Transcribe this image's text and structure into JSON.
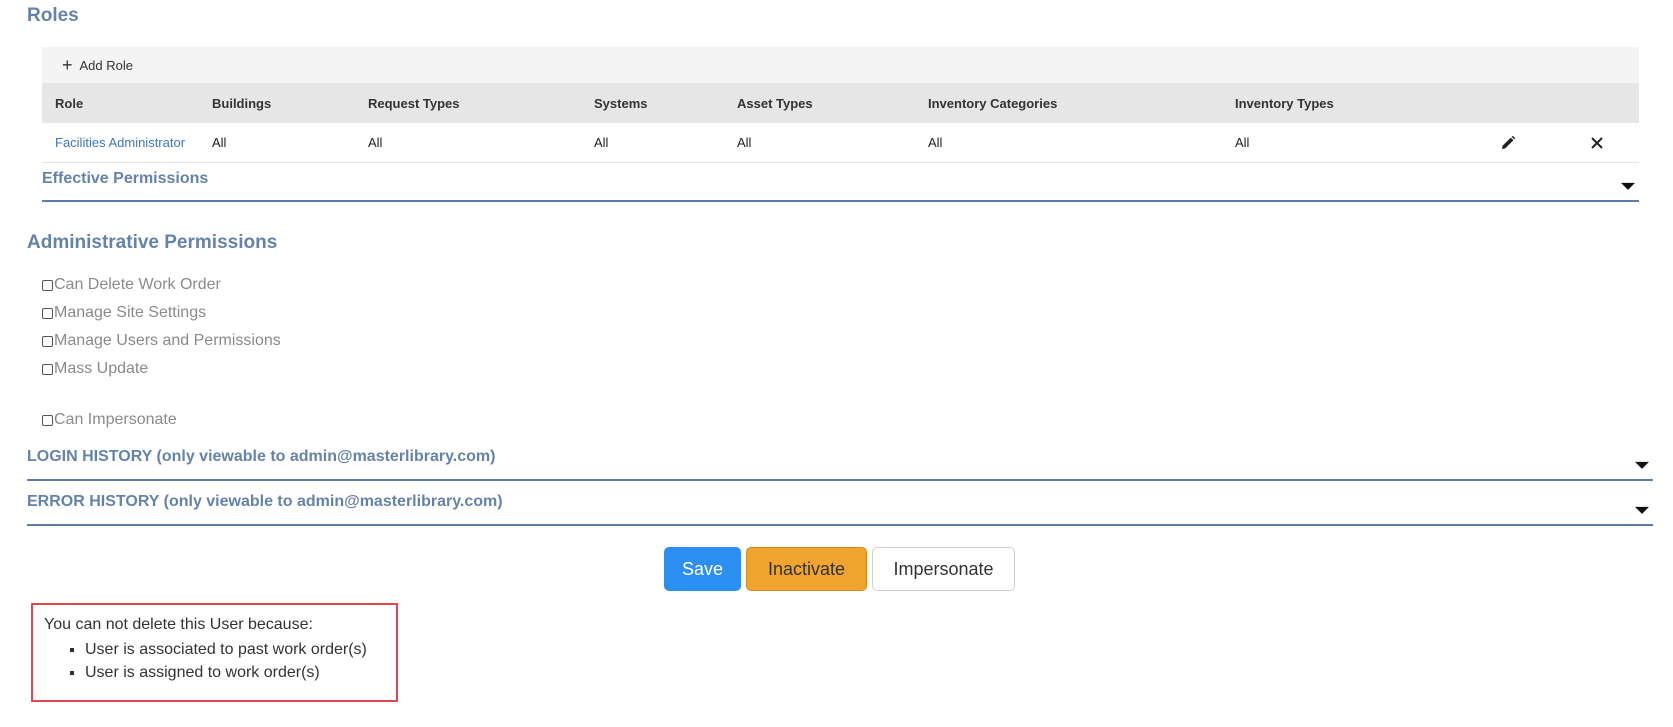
{
  "roles_section": {
    "title": "Roles",
    "add_role_label": "Add Role",
    "columns": [
      "Role",
      "Buildings",
      "Request Types",
      "Systems",
      "Asset Types",
      "Inventory Categories",
      "Inventory Types"
    ],
    "rows": [
      {
        "role": "Facilities Administrator",
        "buildings": "All",
        "request_types": "All",
        "systems": "All",
        "asset_types": "All",
        "inventory_categories": "All",
        "inventory_types": "All"
      }
    ],
    "effective_permissions_label": "Effective Permissions"
  },
  "admin_permissions": {
    "title": "Administrative Permissions",
    "items": [
      {
        "label": "Can Delete Work Order",
        "checked": false
      },
      {
        "label": "Manage Site Settings",
        "checked": false
      },
      {
        "label": "Manage Users and Permissions",
        "checked": false
      },
      {
        "label": "Mass Update",
        "checked": false
      }
    ],
    "impersonate_label": "Can Impersonate"
  },
  "login_history_label": "LOGIN HISTORY (only viewable to admin@masterlibrary.com)",
  "error_history_label": "ERROR HISTORY (only viewable to admin@masterlibrary.com)",
  "buttons": {
    "save": "Save",
    "inactivate": "Inactivate",
    "impersonate": "Impersonate"
  },
  "delete_warning": {
    "intro": "You can not delete this User because:",
    "reasons": [
      "User is associated to past work order(s)",
      "User is assigned to work order(s)"
    ]
  },
  "colors": {
    "heading": "#6583aa",
    "primary": "#2d8ef2",
    "warning": "#f0a32f",
    "error_border": "#e0474c",
    "link": "#3c77c4"
  },
  "icons": {
    "add": "plus-icon",
    "edit": "pencil-icon",
    "delete": "close-icon",
    "expand": "caret-down-icon"
  }
}
